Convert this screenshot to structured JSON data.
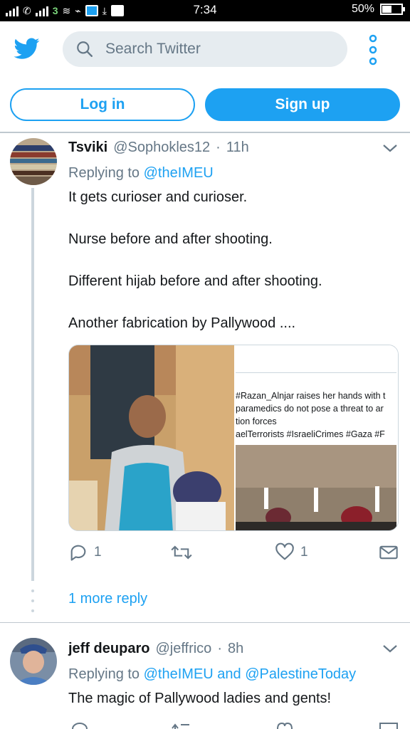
{
  "status_bar": {
    "time": "7:34",
    "battery": "50%",
    "battery_level": 0.5,
    "network_label": "3"
  },
  "header": {
    "logo": "twitter-bird-icon",
    "search_placeholder": "Search Twitter",
    "more_icon": "more-vertical-icon"
  },
  "auth": {
    "login_label": "Log in",
    "signup_label": "Sign up"
  },
  "tweets": [
    {
      "name": "Tsviki",
      "handle": "@Sophokles12",
      "sep": "·",
      "time": "11h",
      "reply_prefix": "Replying to",
      "reply_to": "@theIMEU",
      "reply_joiner": "",
      "reply_to_2": "",
      "body": [
        "It gets curioser and curioser.",
        "Nurse before and after shooting.",
        "Different hijab before and after shooting.",
        "Another fabrication by Pallywood ...."
      ],
      "media_caption": [
        "#Razan_Alnjar raises her hands with t",
        "paramedics do not pose a threat to ar",
        "tion forces",
        "aelTerrorists #IsraeliCrimes #Gaza #F"
      ],
      "replies": "1",
      "retweets": "",
      "likes": "1"
    },
    {
      "name": "jeff deuparo",
      "handle": "@jeffrico",
      "sep": "·",
      "time": "8h",
      "reply_prefix": "Replying to",
      "reply_to": "@theIMEU",
      "reply_joiner": "and",
      "reply_to_2": "@PalestineToday",
      "body": [
        "The magic of Pallywood ladies and gents!"
      ]
    }
  ],
  "thread": {
    "more_replies": "1 more reply"
  },
  "colors": {
    "brand": "#1da1f2",
    "secondary_text": "#657786",
    "primary_text": "#14171a",
    "search_bg": "#e6ecf0"
  }
}
